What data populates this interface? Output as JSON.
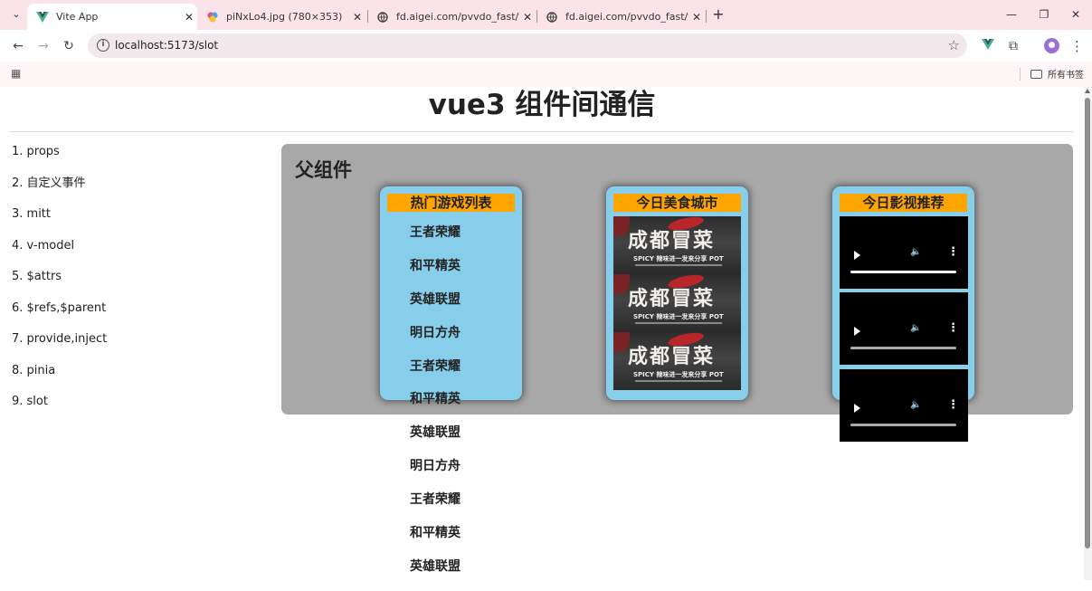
{
  "browser": {
    "tabs": [
      {
        "title": "Vite App",
        "active": true,
        "favicon": "vue-icon"
      },
      {
        "title": "piNxLo4.jpg (780×353)",
        "active": false,
        "favicon": "image-icon"
      },
      {
        "title": "fd.aigei.com/pvvdo_fast/vdo",
        "active": false,
        "favicon": "globe-icon"
      },
      {
        "title": "fd.aigei.com/pvvdo_fast/vdo",
        "active": false,
        "favicon": "globe-icon"
      }
    ],
    "url": "localhost:5173/slot",
    "bookmarks_folder": "所有书签"
  },
  "page": {
    "title": "vue3 组件间通信",
    "nav": [
      "1. props",
      "2. 自定义事件",
      "3. mitt",
      "4. v-model",
      "5. $attrs",
      "6. $refs,$parent",
      "7. provide,inject",
      "8. pinia",
      "9. slot"
    ],
    "parent_title": "父组件",
    "cards": {
      "games": {
        "header": "热门游戏列表",
        "items": [
          "王者荣耀",
          "和平精英",
          "英雄联盟",
          "明日方舟",
          "王者荣耀",
          "和平精英",
          "英雄联盟",
          "明日方舟",
          "王者荣耀",
          "和平精英",
          "英雄联盟"
        ]
      },
      "food": {
        "header": "今日美食城市",
        "image_title": "成都冒菜",
        "image_subtitle": "SPICY 辣味进一发来分享 POT",
        "image_count": 3
      },
      "movies": {
        "header": "今日影视推荐",
        "video_count": 3
      }
    }
  },
  "colors": {
    "tabstrip": "#fbe3ea",
    "parent_bg": "#a8a8a8",
    "card_bg": "#87ceeb",
    "card_header": "#ffa500"
  }
}
